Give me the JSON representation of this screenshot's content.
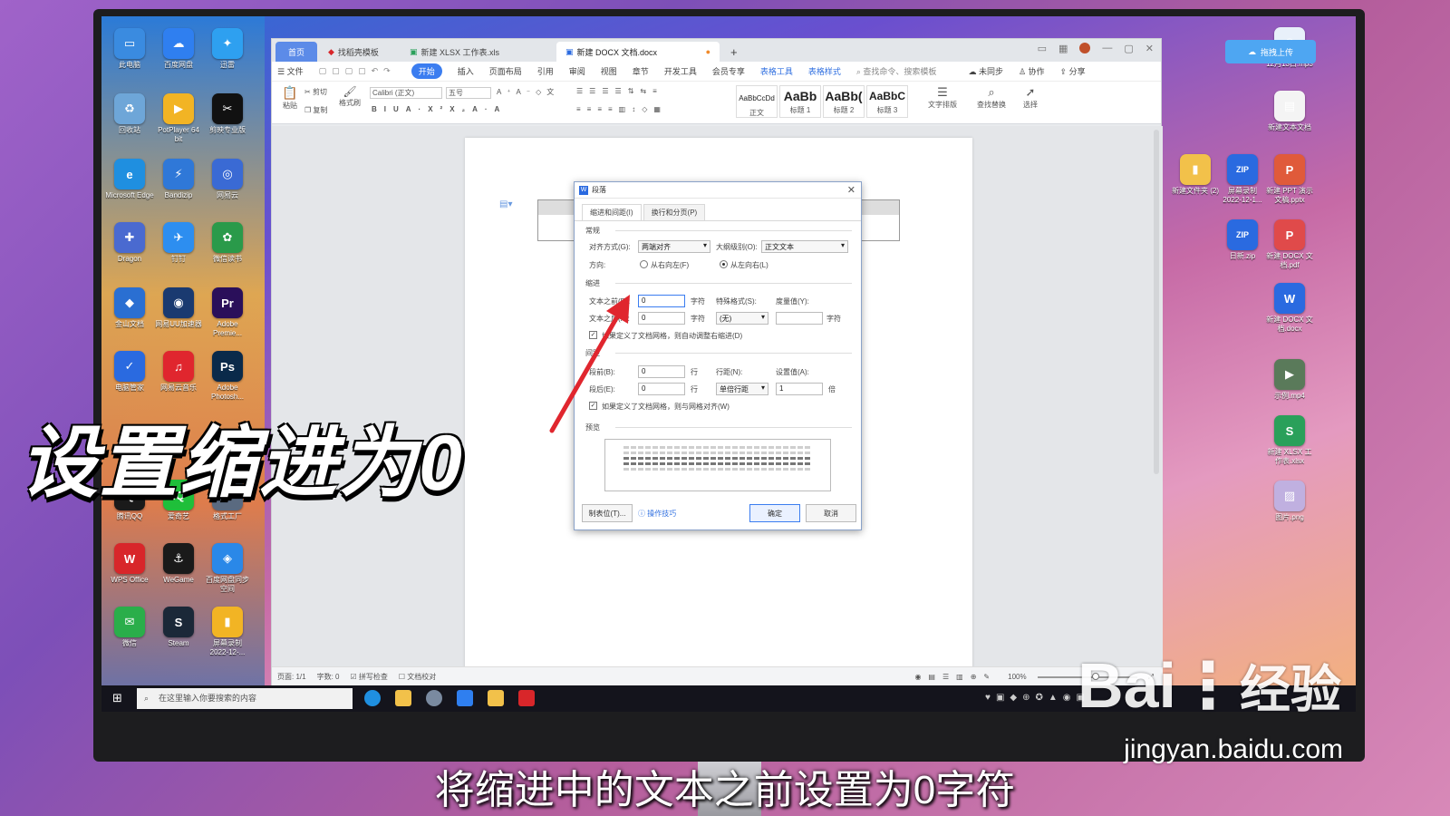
{
  "desktop_icons_left": [
    {
      "label": "此电脑",
      "color": "#3a8be0",
      "glyph": "▭"
    },
    {
      "label": "百度网盘",
      "color": "#2f7ff0",
      "glyph": "☁"
    },
    {
      "label": "迅雷",
      "color": "#2ea0f0",
      "glyph": "✦"
    },
    {
      "label": "回收站",
      "color": "#6ea6d8",
      "glyph": "♻"
    },
    {
      "label": "PotPlayer 64 bit",
      "color": "#f2b424",
      "glyph": "▶"
    },
    {
      "label": "剪映专业版",
      "color": "#111111",
      "glyph": "✂"
    },
    {
      "label": "Microsoft Edge",
      "color": "#1f8fe0",
      "glyph": "e"
    },
    {
      "label": "Bandizip",
      "color": "#2f78d8",
      "glyph": "⚡"
    },
    {
      "label": "网易云",
      "color": "#3a6ad4",
      "glyph": "◎"
    },
    {
      "label": "Dragon",
      "color": "#4a6ad0",
      "glyph": "✚"
    },
    {
      "label": "钉钉",
      "color": "#2d8ef0",
      "glyph": "✈"
    },
    {
      "label": "微信读书",
      "color": "#2a9a4a",
      "glyph": "✿"
    },
    {
      "label": "金山文档",
      "color": "#2a6fd2",
      "glyph": "◆"
    },
    {
      "label": "网易UU加速器",
      "color": "#1a3a70",
      "glyph": "◉"
    },
    {
      "label": "Adobe Premie...",
      "color": "#2a0f5a",
      "glyph": "Pr"
    },
    {
      "label": "电脑管家",
      "color": "#2a6ae0",
      "glyph": "✓"
    },
    {
      "label": "网易云音乐",
      "color": "#e0262e",
      "glyph": "♫"
    },
    {
      "label": "Adobe Photosh...",
      "color": "#0a2a4a",
      "glyph": "Ps"
    },
    {
      "label": "腾讯QQ",
      "color": "#1a1a1a",
      "glyph": "Q"
    },
    {
      "label": "爱奇艺",
      "color": "#1fbf3a",
      "glyph": "iQ"
    },
    {
      "label": "格式工厂",
      "color": "#5a6a80",
      "glyph": "⚙"
    },
    {
      "label": "WPS Office",
      "color": "#d8262a",
      "glyph": "W"
    },
    {
      "label": "WeGame",
      "color": "#1a1a1a",
      "glyph": "⚓"
    },
    {
      "label": "百度网盘同步空间",
      "color": "#2a88e8",
      "glyph": "◈"
    },
    {
      "label": "微信",
      "color": "#2aae4a",
      "glyph": "✉"
    },
    {
      "label": "Steam",
      "color": "#1b2838",
      "glyph": "S"
    },
    {
      "label": "屏幕录制 2022-12-...",
      "color": "#f2b424",
      "glyph": "▮"
    }
  ],
  "desktop_icons_right": [
    {
      "label": "12月13日.mp3",
      "color": "#e8f0fa",
      "glyph": "◎"
    },
    {
      "label": "新建文本文档",
      "color": "#f4f4f4",
      "glyph": "▤"
    },
    {
      "label": "新建文件夹 (2)",
      "color": "#f2c14a",
      "glyph": "▮"
    },
    {
      "label": "屏幕录制 2022-12-1...",
      "color": "#2a6ae0",
      "glyph": "ZIP"
    },
    {
      "label": "新建 PPT 演示文稿.pptx",
      "color": "#e05a3a",
      "glyph": "P"
    },
    {
      "label": "日新.zip",
      "color": "#2a6ae0",
      "glyph": "ZIP"
    },
    {
      "label": "新建 DOCX 文档.pdf",
      "color": "#e04a4a",
      "glyph": "P"
    },
    {
      "label": "新建 DOCX 文档.docx",
      "color": "#2a6ae0",
      "glyph": "W"
    },
    {
      "label": "示例.mp4",
      "color": "#5a7a5a",
      "glyph": "▶"
    },
    {
      "label": "新建 XLSX 工作表.xlsx",
      "color": "#2aa05a",
      "glyph": "S"
    },
    {
      "label": "图片.png",
      "color": "#c0b0e0",
      "glyph": "▨"
    }
  ],
  "cloud_button": "拖拽上传",
  "app": {
    "tabs": [
      {
        "label": "首页"
      },
      {
        "label": "找稻壳模板"
      },
      {
        "label": "新建 XLSX 工作表.xls"
      },
      {
        "label": "新建 DOCX 文档.docx"
      }
    ],
    "add_tab": "+",
    "menu": [
      "文件",
      "开始",
      "插入",
      "页面布局",
      "引用",
      "审阅",
      "视图",
      "章节",
      "开发工具",
      "会员专享",
      "表格工具",
      "表格样式"
    ],
    "search_placeholder": "查找命令、搜索模板",
    "right_menu": [
      "未同步",
      "协作",
      "分享"
    ],
    "ribbon": {
      "paste": "粘贴",
      "cut": "剪切",
      "copy": "复制",
      "format_painter": "格式刷",
      "font": "Calibri (正文)",
      "size": "五号",
      "styles": [
        {
          "sample": "AaBbCcDd",
          "name": "正文"
        },
        {
          "sample": "AaBb",
          "name": "标题 1"
        },
        {
          "sample": "AaBb(",
          "name": "标题 2"
        },
        {
          "sample": "AaBbC",
          "name": "标题 3"
        }
      ],
      "text_layout": "文字排版",
      "find_replace": "查找替换",
      "select": "选择"
    },
    "status": {
      "page": "页面: 1/1",
      "words": "字数: 0",
      "spell": "拼写检查",
      "proof": "文档校对",
      "zoom": "100%"
    }
  },
  "dialog": {
    "title": "段落",
    "tabs": [
      "缩进和间距(I)",
      "换行和分页(P)"
    ],
    "general": "常规",
    "align_label": "对齐方式(G):",
    "align_value": "两端对齐",
    "outline_label": "大纲级别(O):",
    "outline_value": "正文文本",
    "direction_label": "方向:",
    "rtl": "从右向左(F)",
    "ltr": "从左向右(L)",
    "indent": "缩进",
    "before_label": "文本之前(R):",
    "before_value": "0",
    "unit_char": "字符",
    "after_label": "文本之后(X):",
    "after_value": "0",
    "special_label": "特殊格式(S):",
    "special_value": "(无)",
    "measure_label": "度量值(Y):",
    "measure_value": "",
    "auto_indent": "如果定义了文档网格，则自动调整右缩进(D)",
    "spacing": "间距",
    "spacing_before_label": "段前(B):",
    "spacing_before_value": "0",
    "unit_line": "行",
    "spacing_after_label": "段后(E):",
    "spacing_after_value": "0",
    "line_spacing_label": "行距(N):",
    "line_spacing_value": "单倍行距",
    "set_value_label": "设置值(A):",
    "set_value": "1",
    "unit_times": "倍",
    "snap_grid": "如果定义了文档网格，则与网格对齐(W)",
    "preview": "预览",
    "tabs_btn": "制表位(T)...",
    "tips": "操作技巧",
    "ok": "确定",
    "cancel": "取消"
  },
  "taskbar": {
    "search_placeholder": "在这里输入你要搜索的内容"
  },
  "overlay_title": "设置缩进为0",
  "subtitle": "将缩进中的文本之前设置为0字符",
  "watermark": {
    "brand": "Bai",
    "brand_cn": "经验",
    "url": "jingyan.baidu.com"
  }
}
